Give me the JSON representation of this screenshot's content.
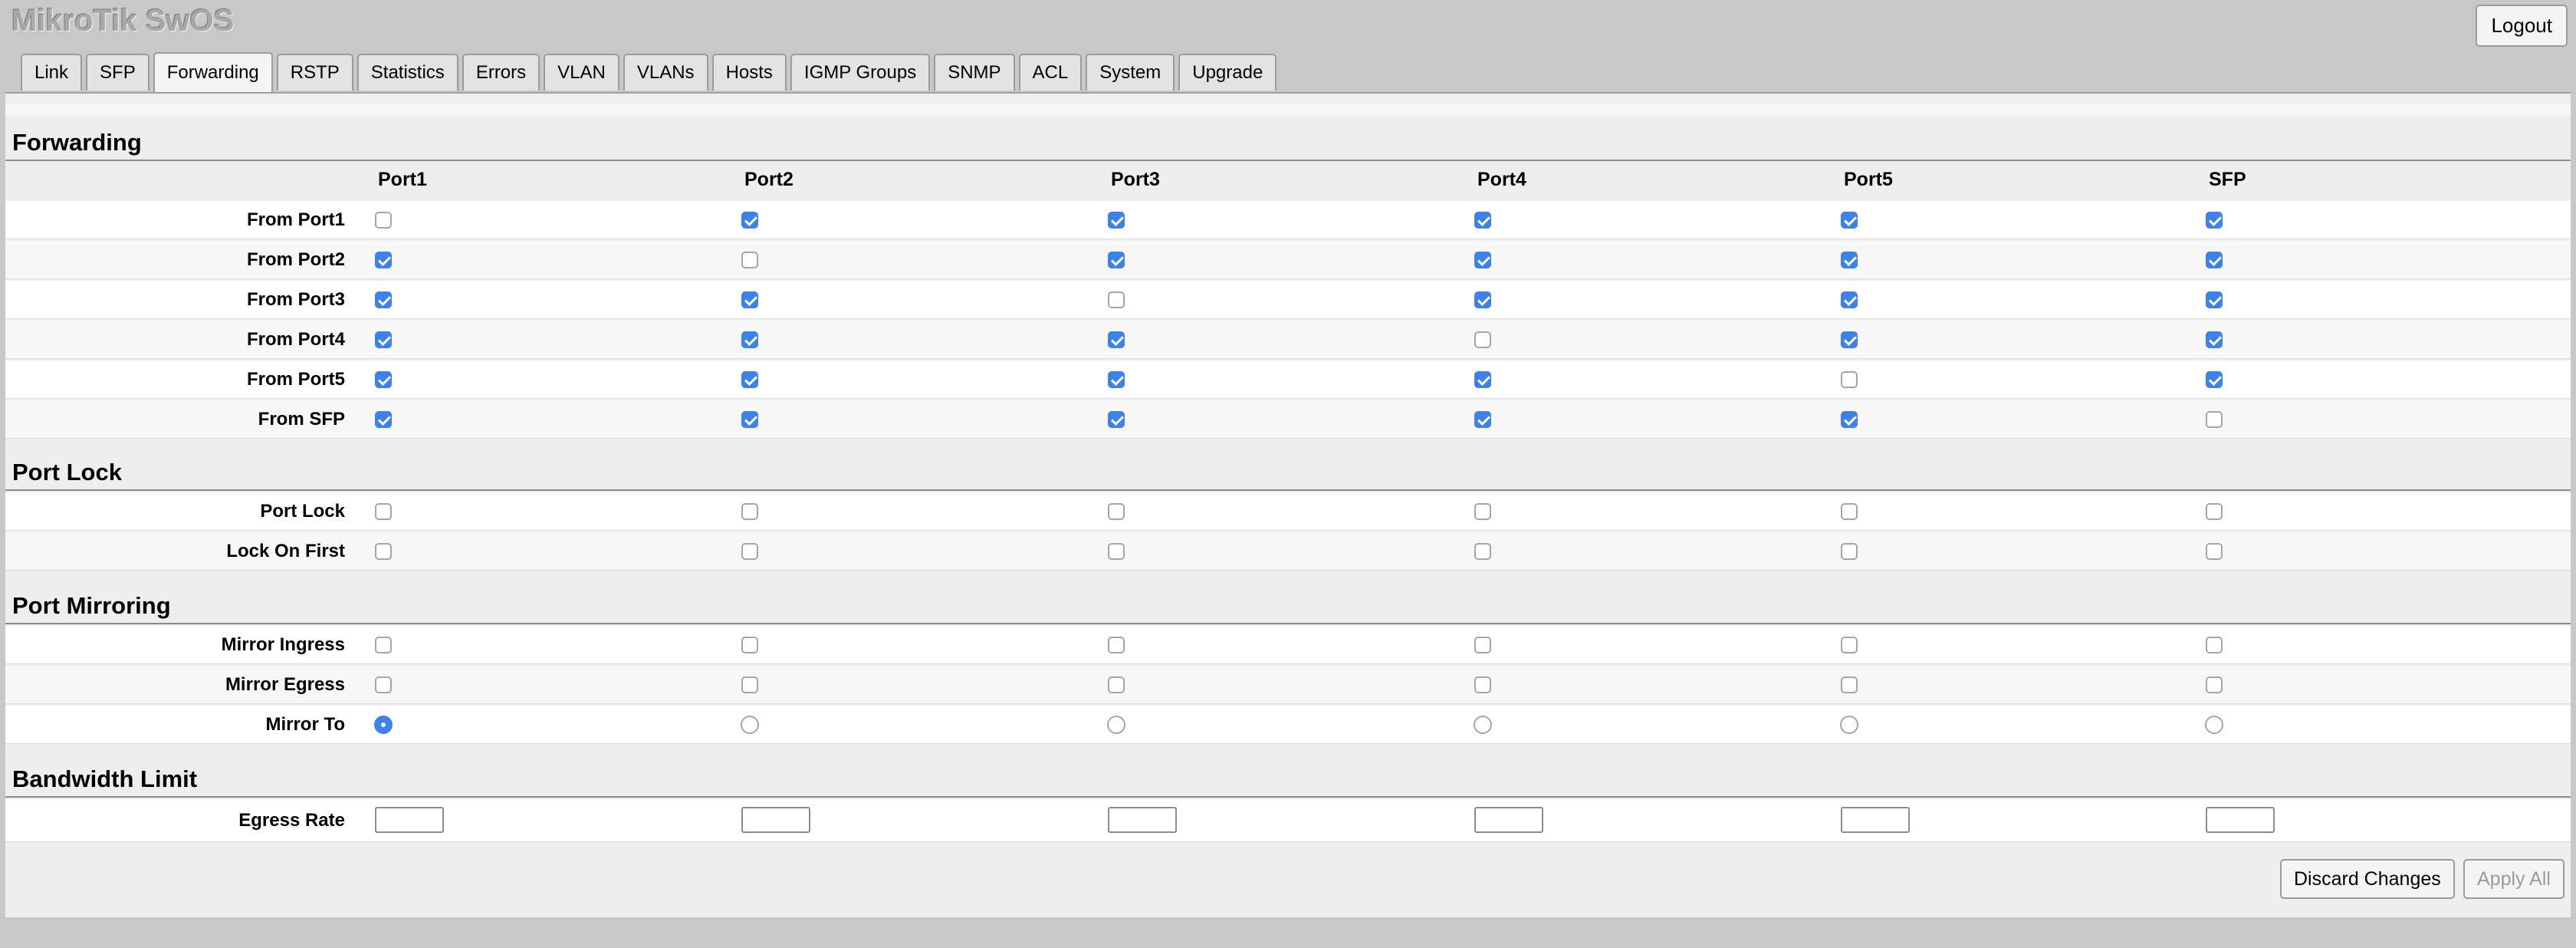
{
  "app": {
    "title": "MikroTik SwOS",
    "logout_label": "Logout"
  },
  "tabs": [
    {
      "label": "Link"
    },
    {
      "label": "SFP"
    },
    {
      "label": "Forwarding",
      "active": true
    },
    {
      "label": "RSTP"
    },
    {
      "label": "Statistics"
    },
    {
      "label": "Errors"
    },
    {
      "label": "VLAN"
    },
    {
      "label": "VLANs"
    },
    {
      "label": "Hosts"
    },
    {
      "label": "IGMP Groups"
    },
    {
      "label": "SNMP"
    },
    {
      "label": "ACL"
    },
    {
      "label": "System"
    },
    {
      "label": "Upgrade"
    }
  ],
  "ports": [
    "Port1",
    "Port2",
    "Port3",
    "Port4",
    "Port5",
    "SFP"
  ],
  "sections": {
    "forwarding": {
      "title": "Forwarding",
      "rows": [
        {
          "label": "From Port1",
          "values": [
            false,
            true,
            true,
            true,
            true,
            true
          ]
        },
        {
          "label": "From Port2",
          "values": [
            true,
            false,
            true,
            true,
            true,
            true
          ]
        },
        {
          "label": "From Port3",
          "values": [
            true,
            true,
            false,
            true,
            true,
            true
          ]
        },
        {
          "label": "From Port4",
          "values": [
            true,
            true,
            true,
            false,
            true,
            true
          ]
        },
        {
          "label": "From Port5",
          "values": [
            true,
            true,
            true,
            true,
            false,
            true
          ]
        },
        {
          "label": "From SFP",
          "values": [
            true,
            true,
            true,
            true,
            true,
            false
          ]
        }
      ]
    },
    "port_lock": {
      "title": "Port Lock",
      "rows": [
        {
          "label": "Port Lock",
          "values": [
            false,
            false,
            false,
            false,
            false,
            false
          ]
        },
        {
          "label": "Lock On First",
          "values": [
            false,
            false,
            false,
            false,
            false,
            false
          ]
        }
      ]
    },
    "port_mirroring": {
      "title": "Port Mirroring",
      "rows": [
        {
          "label": "Mirror Ingress",
          "type": "checkbox",
          "values": [
            false,
            false,
            false,
            false,
            false,
            false
          ]
        },
        {
          "label": "Mirror Egress",
          "type": "checkbox",
          "values": [
            false,
            false,
            false,
            false,
            false,
            false
          ]
        },
        {
          "label": "Mirror To",
          "type": "radio",
          "selected": 0
        }
      ]
    },
    "bandwidth_limit": {
      "title": "Bandwidth Limit",
      "rows": [
        {
          "label": "Egress Rate",
          "values": [
            "",
            "",
            "",
            "",
            "",
            ""
          ]
        }
      ]
    }
  },
  "actions": {
    "discard_label": "Discard Changes",
    "apply_label": "Apply All"
  },
  "colors": {
    "checked": "#3d82e8",
    "background": "#c8c8c8",
    "panel": "#eeeeee"
  }
}
